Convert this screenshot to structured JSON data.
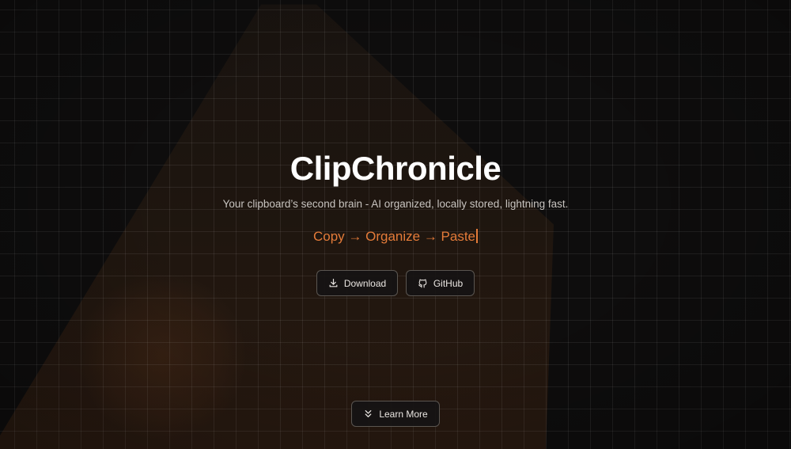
{
  "hero": {
    "title": "ClipChronicle",
    "subtitle": "Your clipboard’s second brain - AI organized, locally stored, lightning fast.",
    "flow_text": "Copy → Organize → Paste"
  },
  "buttons": {
    "download": {
      "label": "Download",
      "icon": "download-icon"
    },
    "github": {
      "label": "GitHub",
      "icon": "github-icon"
    },
    "learn_more": {
      "label": "Learn More",
      "icon": "chevrons-down-icon"
    }
  },
  "colors": {
    "background": "#0e0d0d",
    "accent": "#e47b39",
    "text_primary": "#ffffff",
    "text_secondary": "#c8c4c0",
    "button_border": "#5a5550"
  }
}
